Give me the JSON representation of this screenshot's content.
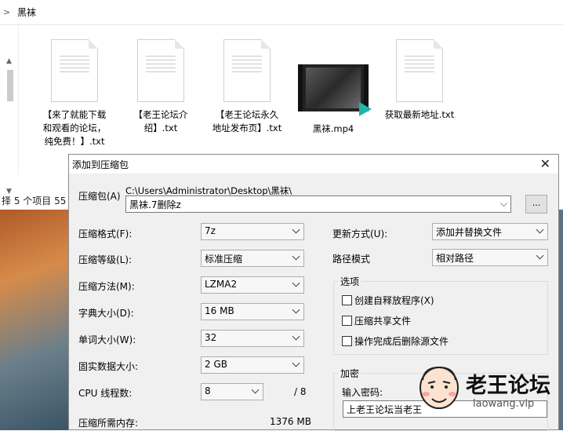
{
  "explorer": {
    "breadcrumb": "黑袜",
    "files": [
      {
        "name_lines": [
          "【来了就能下载",
          "和观看的论坛，",
          "纯免费！】.txt"
        ],
        "kind": "txt"
      },
      {
        "name_lines": [
          "【老王论坛介",
          "绍】.txt"
        ],
        "kind": "txt"
      },
      {
        "name_lines": [
          "【老王论坛永久",
          "地址发布页】.txt"
        ],
        "kind": "txt"
      },
      {
        "name_lines": [
          "黑袜.mp4"
        ],
        "kind": "video"
      },
      {
        "name_lines": [
          "获取最新地址.txt"
        ],
        "kind": "txt"
      }
    ],
    "status": "择 5 个项目   55"
  },
  "dialog": {
    "title": "添加到压缩包",
    "archive_label": "压缩包(A)",
    "archive_path": "C:\\Users\\Administrator\\Desktop\\黑袜\\",
    "archive_name": "黑袜.7删除z",
    "browse_label": "...",
    "fields": [
      {
        "label": "压缩格式(F):",
        "value": "7z"
      },
      {
        "label": "压缩等级(L):",
        "value": "标准压缩"
      },
      {
        "label": "压缩方法(M):",
        "value": "LZMA2"
      },
      {
        "label": "字典大小(D):",
        "value": "16 MB"
      },
      {
        "label": "单词大小(W):",
        "value": "32"
      },
      {
        "label": "固实数据大小:",
        "value": "2 GB"
      }
    ],
    "threads": {
      "label": "CPU 线程数:",
      "value": "8",
      "max": "/ 8"
    },
    "memory": {
      "label": "压缩所需内存:",
      "value": "1376 MB"
    },
    "update_mode": {
      "label": "更新方式(U):",
      "value": "添加并替换文件"
    },
    "path_mode": {
      "label": "路径模式",
      "value": "相对路径"
    },
    "options": {
      "title": "选项",
      "items": [
        "创建自释放程序(X)",
        "压缩共享文件",
        "操作完成后删除源文件"
      ]
    },
    "encryption": {
      "title": "加密",
      "password_label": "输入密码:",
      "password_value": "上老王论坛当老王"
    }
  },
  "watermark": {
    "title": "老王论坛",
    "url": "laowang.vip"
  }
}
